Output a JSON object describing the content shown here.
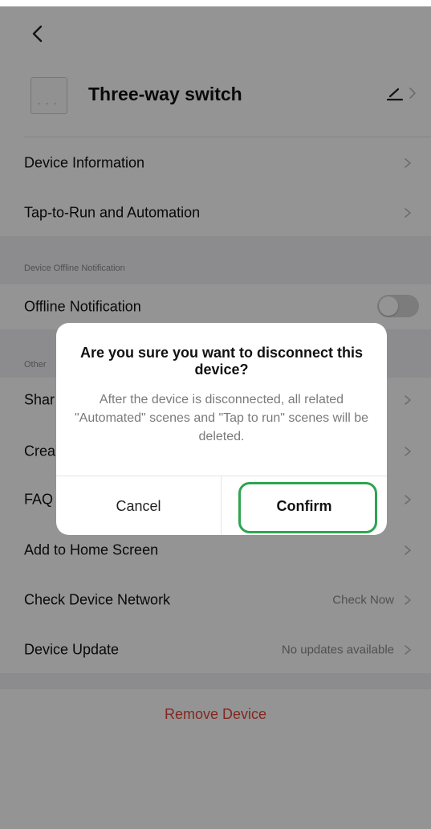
{
  "device": {
    "name": "Three-way switch",
    "thumbnail_text": "- - -"
  },
  "menu": {
    "device_information": "Device Information",
    "tap_to_run": "Tap-to-Run and Automation"
  },
  "offline_section": {
    "header": "Device Offline Notification",
    "offline_notification_label": "Offline Notification",
    "offline_notification_on": false
  },
  "others_section": {
    "header": "Other",
    "share_partial": "Shar",
    "create_partial": "Crea",
    "faq_partial": "FAQ",
    "add_to_home": "Add to Home Screen",
    "check_network": "Check Device Network",
    "check_network_value": "Check Now",
    "device_update": "Device Update",
    "device_update_value": "No updates available"
  },
  "remove_device": "Remove Device",
  "dialog": {
    "title": "Are you sure you want to disconnect this device?",
    "message": "After the device is disconnected, all related \"Automated\" scenes and \"Tap to run\" scenes will be deleted.",
    "cancel_label": "Cancel",
    "confirm_label": "Confirm"
  },
  "colors": {
    "remove_red": "#e0453a",
    "highlight_green": "#2ea44f",
    "overlay": "rgba(0,0,0,0.42)",
    "toggle_off": "#d6d6d6"
  }
}
